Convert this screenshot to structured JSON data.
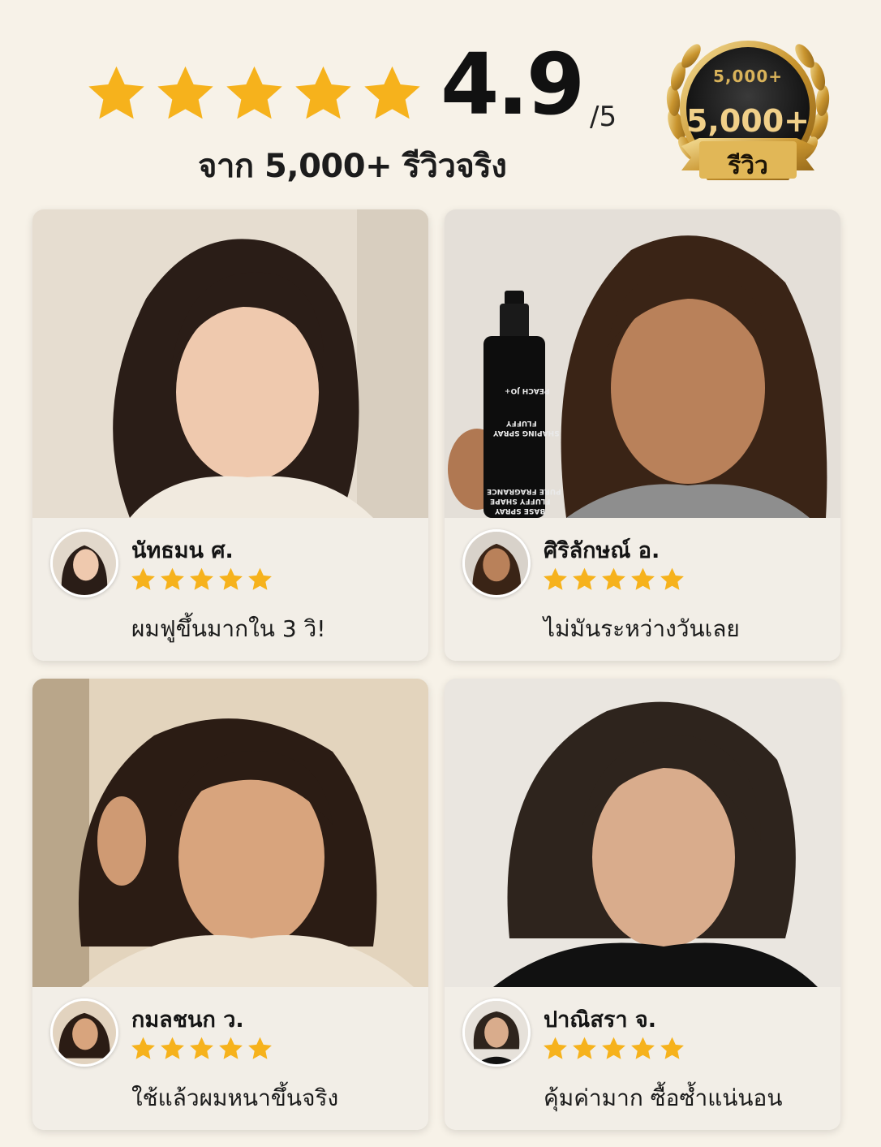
{
  "rating": {
    "score": "4.9",
    "denominator": "/5",
    "stars": 5,
    "subtitle": "จาก 5,000+ รีวิวจริง",
    "star_color": "#f6b21c"
  },
  "badge": {
    "small_text": "5,000+",
    "count": "5,000+",
    "ribbon_text": "รีวิว",
    "gold_color": "#d4a53f"
  },
  "reviews": [
    {
      "name": "นัทธมน ศ.",
      "rating": 5,
      "comment": "ผมฟูขึ้นมากใน 3 วิ!"
    },
    {
      "name": "ศิริลักษณ์ อ.",
      "rating": 5,
      "comment": "ไม่มันระหว่างวันเลย"
    },
    {
      "name": "กมลชนก ว.",
      "rating": 5,
      "comment": "ใช้แล้วผมหนาขึ้นจริง"
    },
    {
      "name": "ปาณิสรา จ.",
      "rating": 5,
      "comment": "คุ้มค่ามาก ซื้อซ้ำแน่นอน"
    }
  ],
  "product": {
    "brand": "PEACH JO+",
    "line1": "FLUFFY",
    "line2": "SHAPING SPRAY",
    "line3": "PURE FRAGRANCE",
    "line4": "FLUFFY SHAPE",
    "line5": "BASE SPRAY"
  }
}
